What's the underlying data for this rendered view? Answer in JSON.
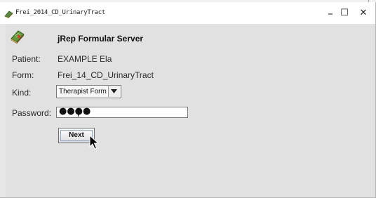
{
  "window": {
    "title": "Frei_2014_CD_UrinaryTract",
    "controls": {
      "minimize": "–",
      "maximize": "☐",
      "close": "✕"
    }
  },
  "app": {
    "name": "jRep Formular Server"
  },
  "form": {
    "patient_label": "Patient:",
    "patient_value": "EXAMPLE Ela",
    "form_label": "Form:",
    "form_value": "Frei_14_CD_UrinaryTract",
    "kind_label": "Kind:",
    "kind_value": "Therapist Form",
    "password_label": "Password:",
    "password_value": "●●●●",
    "next_label": "Next"
  },
  "colors": {
    "background": "#e1e1e1",
    "titlebar": "#ffffff"
  }
}
